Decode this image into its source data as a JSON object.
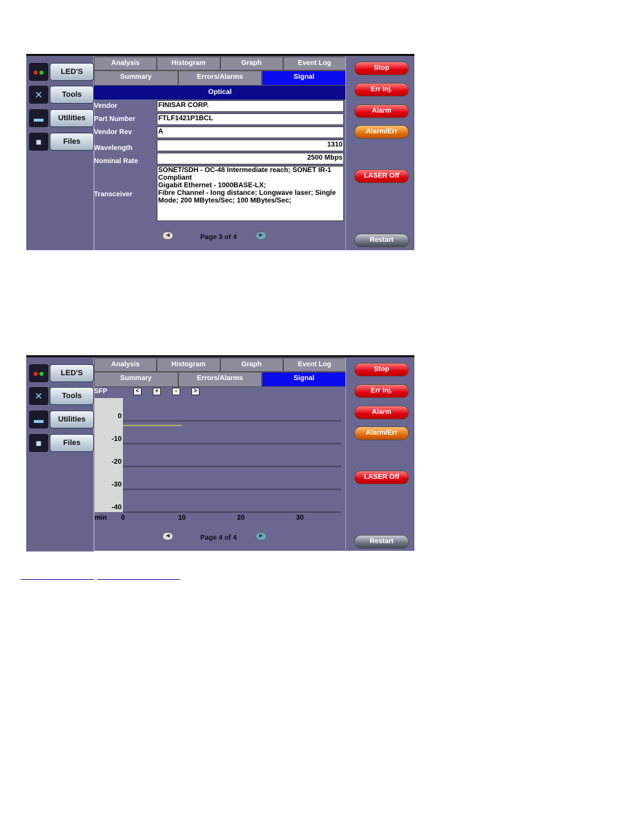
{
  "sidebar": {
    "items": [
      {
        "label": "LED'S",
        "icon": "led-icon"
      },
      {
        "label": "Tools",
        "icon": "tools-icon"
      },
      {
        "label": "Utilities",
        "icon": "utilities-icon"
      },
      {
        "label": "Files",
        "icon": "files-icon"
      }
    ]
  },
  "tabs": {
    "row1": [
      "Analysis",
      "Histogram",
      "Graph",
      "Event Log"
    ],
    "row2": [
      "Summary",
      "Errors/Alarms",
      "Signal"
    ],
    "active": "Signal"
  },
  "right_buttons": {
    "stop": "Stop",
    "err_inj": "Err Inj.",
    "alarm": "Alarm",
    "alarm_err": "Alarm/Err",
    "laser": "LASER Off",
    "restart": "Restart"
  },
  "screen1": {
    "header": "Optical",
    "rows": [
      {
        "label": "Vendor",
        "value": "FINISAR CORP."
      },
      {
        "label": "Part Number",
        "value": "FTLF1421P1BCL"
      },
      {
        "label": "Vendor Rev",
        "value": "A"
      },
      {
        "label": "Wavelength",
        "value": "1310"
      },
      {
        "label": "Nominal Rate",
        "value": "2500 Mbps"
      }
    ],
    "transceiver": {
      "label": "Transceiver",
      "lines": [
        "SONET/SDH - OC-48 Intermediate reach; SONET IR-1 Compliant",
        "Gigabit Ethernet -  1000BASE-LX;",
        "Fibre Channel - long distance; Longwave laser; Single Mode; 200 MBytes/Sec; 100 MBytes/Sec;"
      ]
    },
    "page": "Page 3 of 4"
  },
  "screen2": {
    "title": "SFP",
    "controls": [
      "<",
      "+",
      "-",
      ">"
    ],
    "page": "Page 4 of 4",
    "chart_data": {
      "type": "line",
      "xlabel": "min",
      "x_ticks": [
        "0",
        "10",
        "20",
        "30"
      ],
      "y_ticks": [
        "0",
        "-10",
        "-20",
        "-30",
        "-40"
      ],
      "ylim": [
        -40,
        0
      ],
      "xlim": [
        0,
        37
      ],
      "grid": true,
      "series": [
        {
          "x": [
            0,
            10
          ],
          "y": [
            -2,
            -2
          ],
          "color": "#c8c060"
        }
      ]
    }
  },
  "colors": {
    "background": "#6a6890",
    "active_tab": "#0b0bf0",
    "header": "#0a0a8a",
    "red_button": "#e00010",
    "orange_button": "#e07010"
  }
}
